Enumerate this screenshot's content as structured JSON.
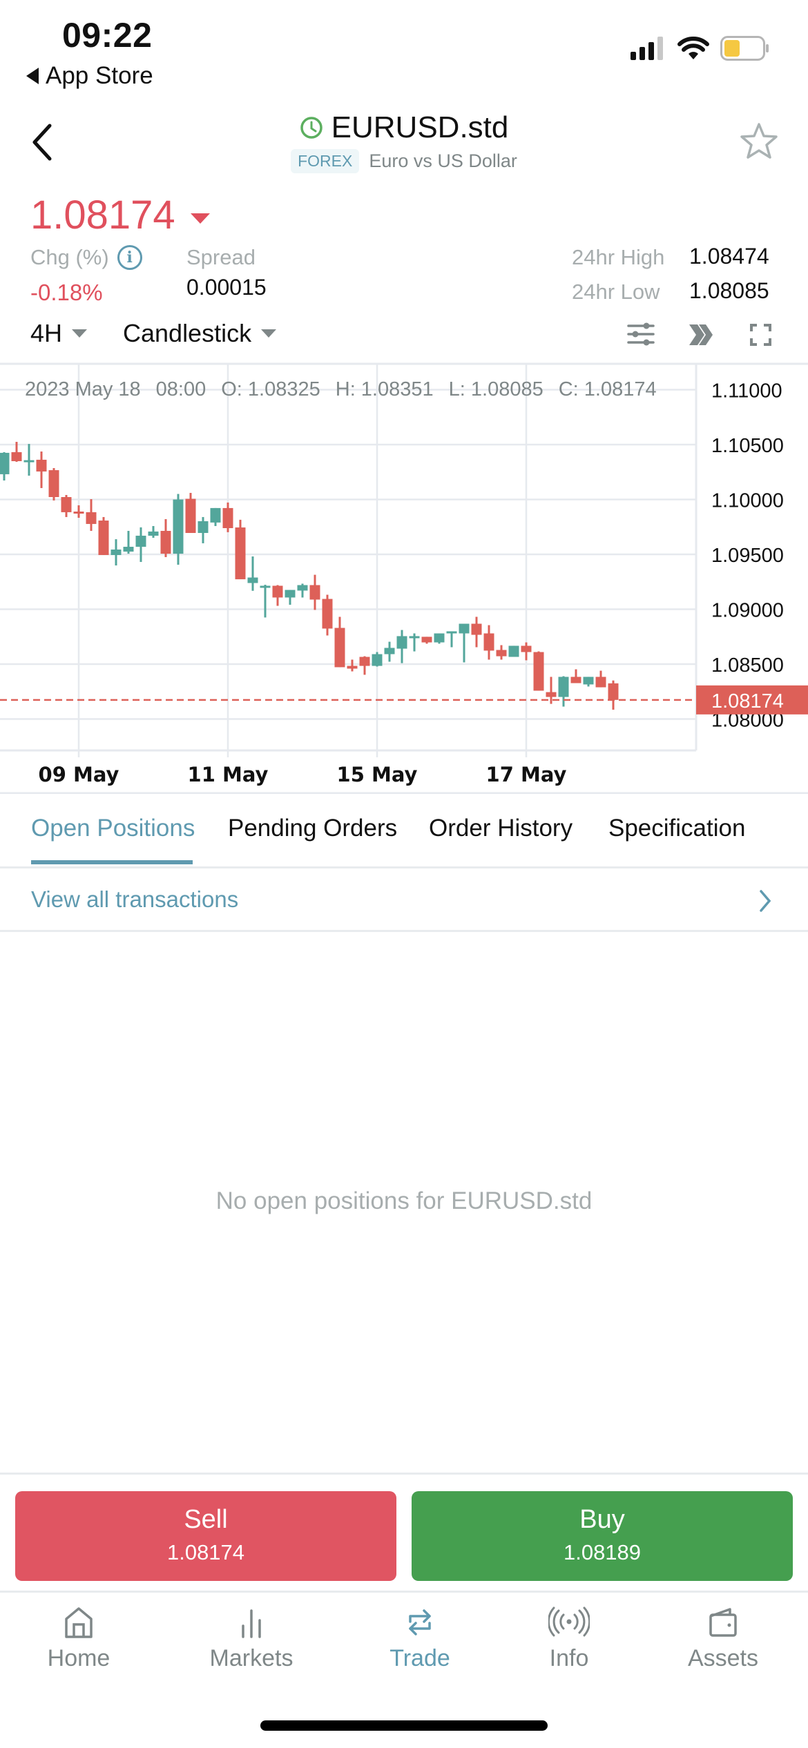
{
  "status_bar": {
    "time": "09:22",
    "back_app": "App Store",
    "battery_color": "#f5c842"
  },
  "header": {
    "symbol": "EURUSD.std",
    "category_tag": "FOREX",
    "description": "Euro vs US Dollar"
  },
  "quote": {
    "price": "1.08174",
    "direction": "down",
    "chg_label": "Chg (%)",
    "chg_value": "-0.18%",
    "spread_label": "Spread",
    "spread_value": "0.00015",
    "high_label": "24hr High",
    "high_value": "1.08474",
    "low_label": "24hr Low",
    "low_value": "1.08085"
  },
  "chart_toolbar": {
    "period": "4H",
    "chart_type": "Candlestick",
    "icons": [
      "indicator-settings-icon",
      "scroll-to-latest-icon",
      "fullscreen-icon"
    ]
  },
  "ohlc_readout": {
    "date": "2023 May 18",
    "time": "08:00",
    "open": "O: 1.08325",
    "high": "H: 1.08351",
    "low": "L: 1.08085",
    "close": "C: 1.08174"
  },
  "colors": {
    "up": "#53a69b",
    "down": "#dd6058",
    "accent": "#5f9ab0",
    "sell": "#e05562",
    "buy": "#459f4f"
  },
  "chart_data": {
    "type": "candlestick",
    "title": "EURUSD.std 4H",
    "ylim": [
      1.0771,
      1.1116
    ],
    "y_ticks": [
      "1.11000",
      "1.10500",
      "1.10000",
      "1.09500",
      "1.09000",
      "1.08500",
      "1.08000"
    ],
    "y_tick_values": [
      1.11,
      1.105,
      1.1,
      1.095,
      1.09,
      1.085,
      1.08
    ],
    "x_ticks": [
      {
        "label": "09 May",
        "index": 6
      },
      {
        "label": "11 May",
        "index": 18
      },
      {
        "label": "15 May",
        "index": 30
      },
      {
        "label": "17 May",
        "index": 42
      }
    ],
    "current_price": 1.08174,
    "current_price_label": "1.08174",
    "candles": [
      {
        "o": 1.1023,
        "h": 1.10431,
        "l": 1.10173,
        "c": 1.10425
      },
      {
        "o": 1.10431,
        "h": 1.10525,
        "l": 1.10343,
        "c": 1.10349
      },
      {
        "o": 1.10355,
        "h": 1.10506,
        "l": 1.10217,
        "c": 1.10358
      },
      {
        "o": 1.10362,
        "h": 1.10437,
        "l": 1.10104,
        "c": 1.10255
      },
      {
        "o": 1.10267,
        "h": 1.10286,
        "l": 1.09991,
        "c": 1.10022
      },
      {
        "o": 1.10022,
        "h": 1.10041,
        "l": 1.0984,
        "c": 1.09884
      },
      {
        "o": 1.0989,
        "h": 1.09947,
        "l": 1.09833,
        "c": 1.0988
      },
      {
        "o": 1.09884,
        "h": 1.10003,
        "l": 1.09714,
        "c": 1.09777
      },
      {
        "o": 1.09808,
        "h": 1.0984,
        "l": 1.09494,
        "c": 1.09494
      },
      {
        "o": 1.09494,
        "h": 1.09638,
        "l": 1.09399,
        "c": 1.09544
      },
      {
        "o": 1.09525,
        "h": 1.09714,
        "l": 1.09506,
        "c": 1.09569
      },
      {
        "o": 1.09569,
        "h": 1.09746,
        "l": 1.09431,
        "c": 1.0967
      },
      {
        "o": 1.0967,
        "h": 1.09758,
        "l": 1.09651,
        "c": 1.09708
      },
      {
        "o": 1.09714,
        "h": 1.09821,
        "l": 1.09475,
        "c": 1.09506
      },
      {
        "o": 1.09506,
        "h": 1.1005,
        "l": 1.09406,
        "c": 1.1
      },
      {
        "o": 1.10006,
        "h": 1.1006,
        "l": 1.09695,
        "c": 1.09695
      },
      {
        "o": 1.09695,
        "h": 1.0984,
        "l": 1.09601,
        "c": 1.09802
      },
      {
        "o": 1.0979,
        "h": 1.09922,
        "l": 1.09758,
        "c": 1.09922
      },
      {
        "o": 1.09922,
        "h": 1.09972,
        "l": 1.09702,
        "c": 1.09739
      },
      {
        "o": 1.09745,
        "h": 1.09815,
        "l": 1.09275,
        "c": 1.09273
      },
      {
        "o": 1.09239,
        "h": 1.09481,
        "l": 1.09168,
        "c": 1.09289
      },
      {
        "o": 1.09202,
        "h": 1.09223,
        "l": 1.08925,
        "c": 1.09214
      },
      {
        "o": 1.09214,
        "h": 1.0922,
        "l": 1.09031,
        "c": 1.09107
      },
      {
        "o": 1.09107,
        "h": 1.09176,
        "l": 1.09041,
        "c": 1.09176
      },
      {
        "o": 1.0917,
        "h": 1.09233,
        "l": 1.09107,
        "c": 1.0922
      },
      {
        "o": 1.0922,
        "h": 1.09314,
        "l": 1.08994,
        "c": 1.09088
      },
      {
        "o": 1.09094,
        "h": 1.09132,
        "l": 1.08761,
        "c": 1.08824
      },
      {
        "o": 1.0883,
        "h": 1.08931,
        "l": 1.08472,
        "c": 1.08472
      },
      {
        "o": 1.08484,
        "h": 1.08541,
        "l": 1.08434,
        "c": 1.08459
      },
      {
        "o": 1.08566,
        "h": 1.08572,
        "l": 1.08403,
        "c": 1.08484
      },
      {
        "o": 1.08484,
        "h": 1.0861,
        "l": 1.08478,
        "c": 1.08591
      },
      {
        "o": 1.08591,
        "h": 1.08704,
        "l": 1.08522,
        "c": 1.08648
      },
      {
        "o": 1.08641,
        "h": 1.08811,
        "l": 1.08509,
        "c": 1.08755
      },
      {
        "o": 1.08736,
        "h": 1.0878,
        "l": 1.08616,
        "c": 1.08755
      },
      {
        "o": 1.08749,
        "h": 1.08749,
        "l": 1.08686,
        "c": 1.08698
      },
      {
        "o": 1.08698,
        "h": 1.0878,
        "l": 1.08686,
        "c": 1.0878
      },
      {
        "o": 1.0878,
        "h": 1.08793,
        "l": 1.08654,
        "c": 1.08799
      },
      {
        "o": 1.0878,
        "h": 1.08868,
        "l": 1.08516,
        "c": 1.08868
      },
      {
        "o": 1.08868,
        "h": 1.08931,
        "l": 1.08654,
        "c": 1.08767
      },
      {
        "o": 1.0878,
        "h": 1.08855,
        "l": 1.08541,
        "c": 1.08623
      },
      {
        "o": 1.08629,
        "h": 1.08673,
        "l": 1.08541,
        "c": 1.08572
      },
      {
        "o": 1.08566,
        "h": 1.08667,
        "l": 1.08566,
        "c": 1.08667
      },
      {
        "o": 1.08667,
        "h": 1.08698,
        "l": 1.08535,
        "c": 1.0861
      },
      {
        "o": 1.0861,
        "h": 1.08616,
        "l": 1.08258,
        "c": 1.08258
      },
      {
        "o": 1.08245,
        "h": 1.08384,
        "l": 1.08138,
        "c": 1.08201
      },
      {
        "o": 1.08201,
        "h": 1.0839,
        "l": 1.08113,
        "c": 1.08384
      },
      {
        "o": 1.08384,
        "h": 1.08453,
        "l": 1.08327,
        "c": 1.08327
      },
      {
        "o": 1.08315,
        "h": 1.08384,
        "l": 1.08296,
        "c": 1.08384
      },
      {
        "o": 1.08384,
        "h": 1.0844,
        "l": 1.08289,
        "c": 1.08289
      },
      {
        "o": 1.08325,
        "h": 1.08351,
        "l": 1.08085,
        "c": 1.08174
      }
    ]
  },
  "tabs": [
    {
      "label": "Open Positions",
      "active": true
    },
    {
      "label": "Pending Orders",
      "active": false
    },
    {
      "label": "Order History",
      "active": false
    },
    {
      "label": "Specification",
      "active": false
    }
  ],
  "view_all": "View all transactions",
  "empty_state": "No open positions for EURUSD.std",
  "trade": {
    "sell_label": "Sell",
    "sell_price": "1.08174",
    "buy_label": "Buy",
    "buy_price": "1.08189"
  },
  "bottom_nav": [
    {
      "label": "Home",
      "icon": "home-icon",
      "active": false
    },
    {
      "label": "Markets",
      "icon": "bar-chart-icon",
      "active": false
    },
    {
      "label": "Trade",
      "icon": "swap-arrows-icon",
      "active": true
    },
    {
      "label": "Info",
      "icon": "broadcast-icon",
      "active": false
    },
    {
      "label": "Assets",
      "icon": "wallet-icon",
      "active": false
    }
  ]
}
